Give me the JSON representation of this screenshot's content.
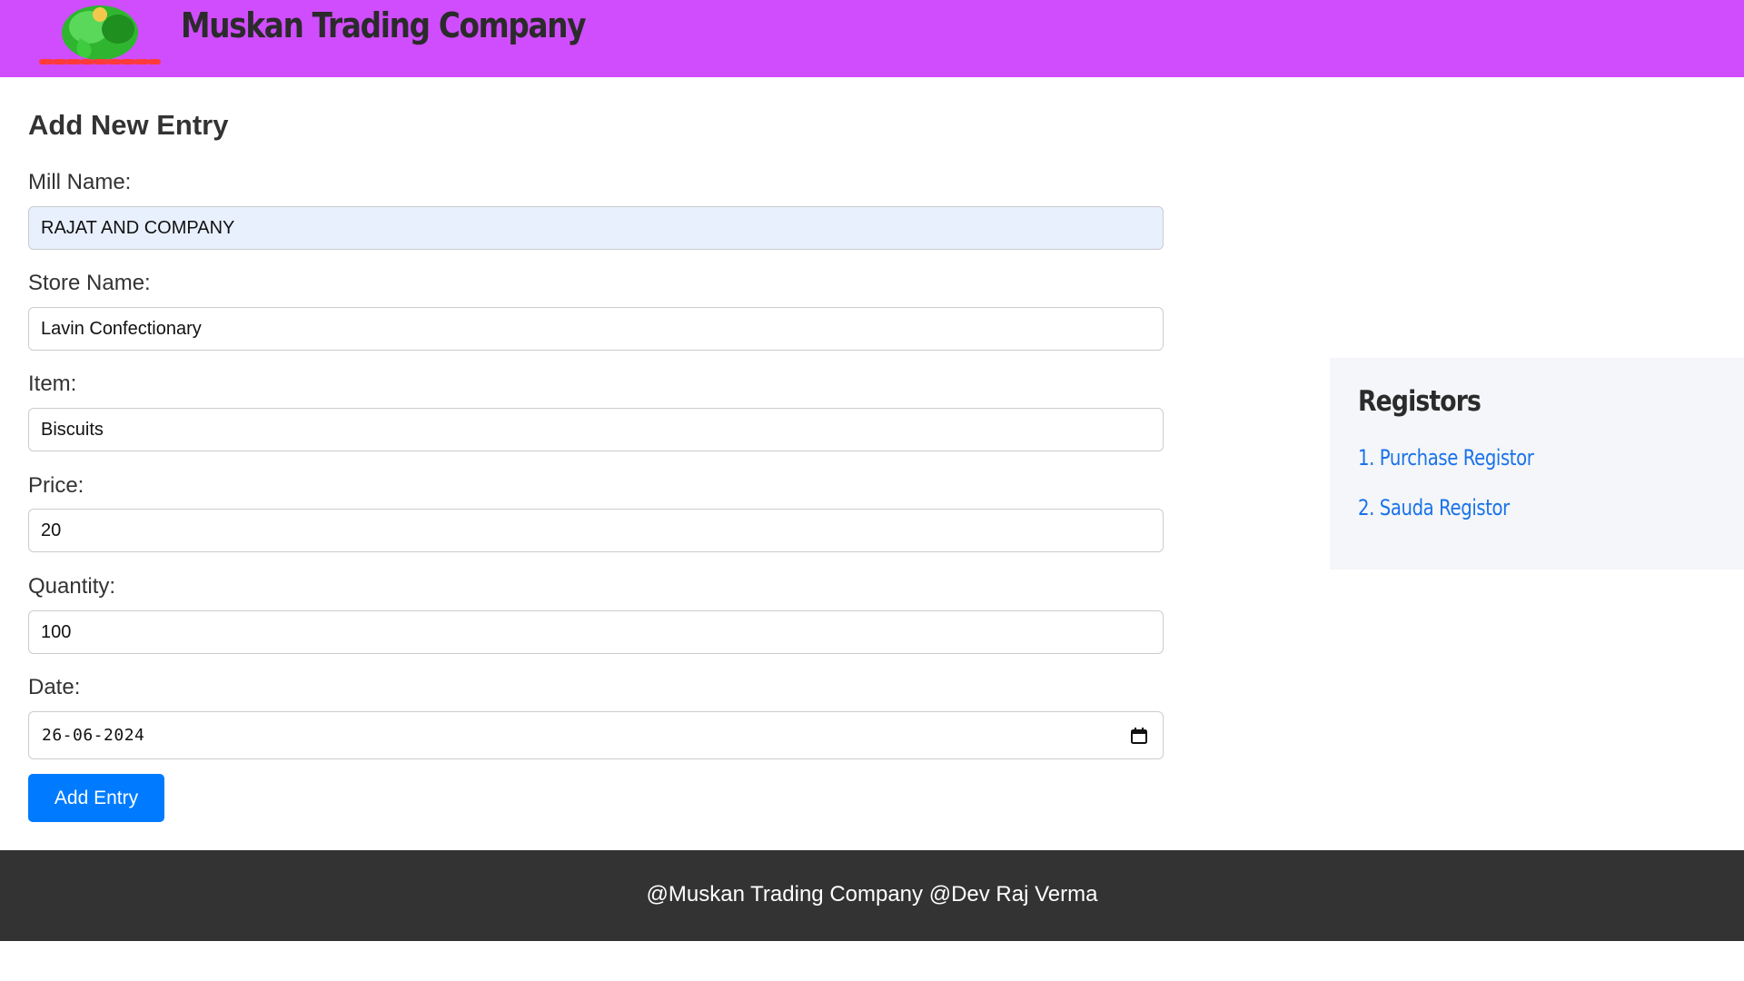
{
  "header": {
    "brand": "Muskan Trading Company",
    "logo_icon": "ganesha-logo-icon"
  },
  "form": {
    "title": "Add New Entry",
    "mill_name": {
      "label": "Mill Name:",
      "value": "RAJAT AND COMPANY"
    },
    "store_name": {
      "label": "Store Name:",
      "value": "Lavin Confectionary"
    },
    "item": {
      "label": "Item:",
      "value": "Biscuits"
    },
    "price": {
      "label": "Price:",
      "value": "20"
    },
    "quantity": {
      "label": "Quantity:",
      "value": "100"
    },
    "date": {
      "label": "Date:",
      "value": "26-06-2024",
      "icon": "calendar-icon"
    },
    "submit_label": "Add Entry"
  },
  "sidebar": {
    "title": "Registors",
    "links": [
      {
        "label": "1. Purchase Registor"
      },
      {
        "label": "2. Sauda Registor"
      }
    ]
  },
  "footer": {
    "text": "@Muskan Trading Company @Dev Raj Verma"
  },
  "colors": {
    "header_bg": "#d04dfd",
    "button_bg": "#007bff",
    "link": "#1a73e8",
    "footer_bg": "#333333",
    "autofill_bg": "#e8f0fe"
  }
}
